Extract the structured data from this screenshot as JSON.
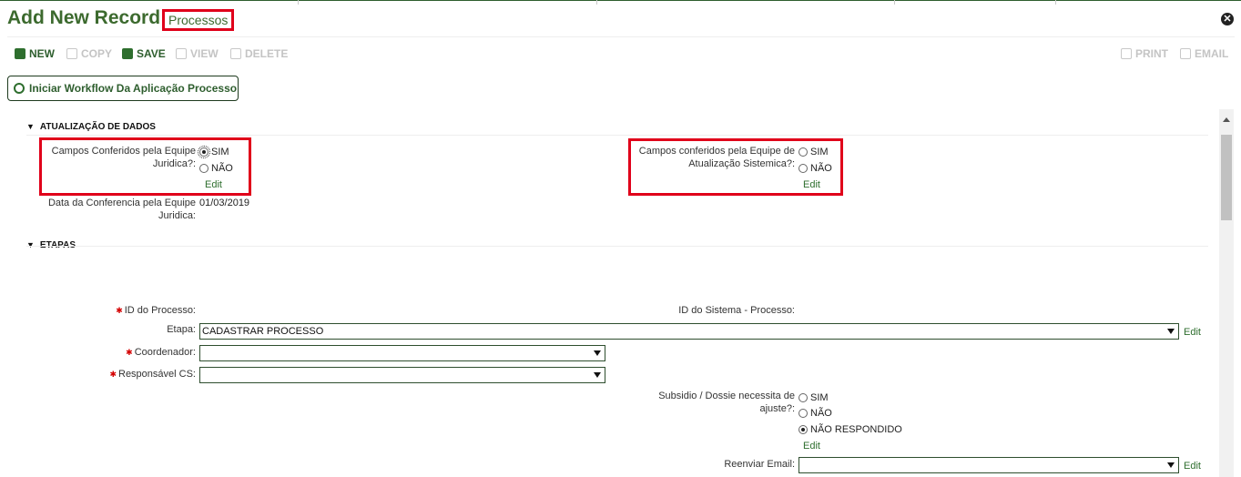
{
  "header": {
    "title": "Add New Record",
    "breadcrumb": "Processos",
    "close_icon": "close-circle-icon"
  },
  "toolbar": {
    "new": "NEW",
    "copy": "COPY",
    "save": "SAVE",
    "view": "VIEW",
    "delete": "DELETE",
    "print": "PRINT",
    "email": "EMAIL"
  },
  "workflow_button": "Iniciar Workflow Da Aplicação Processo",
  "sections": {
    "atualizacao": {
      "title": "ATUALIZAÇÃO DE DADOS",
      "campos_juridica": {
        "label": "Campos Conferidos pela Equipe Juridica?:",
        "options": [
          "SIM",
          "NÃO"
        ],
        "selected": "SIM",
        "edit": "Edit"
      },
      "campos_sistemica": {
        "label": "Campos conferidos pela Equipe de Atualização Sistemica?:",
        "options": [
          "SIM",
          "NÃO"
        ],
        "selected": "",
        "edit": "Edit"
      },
      "data_conferencia": {
        "label": "Data da Conferencia pela Equipe Juridica:",
        "value": "01/03/2019"
      }
    },
    "etapas": {
      "title": "ETAPAS",
      "id_processo": {
        "label": "ID do Processo:"
      },
      "id_sistema": {
        "label": "ID do Sistema - Processo:"
      },
      "etapa": {
        "label": "Etapa:",
        "value": "CADASTRAR PROCESSO",
        "edit": "Edit"
      },
      "coordenador": {
        "label": "Coordenador:",
        "value": ""
      },
      "responsavel": {
        "label": "Responsável CS:",
        "value": ""
      },
      "subsidio": {
        "label": "Subsidio / Dossie necessita de ajuste?:",
        "options": [
          "SIM",
          "NÃO",
          "NÃO RESPONDIDO"
        ],
        "selected": "NÃO RESPONDIDO",
        "edit": "Edit"
      },
      "reenviar": {
        "label": "Reenviar Email:",
        "value": "",
        "edit": "Edit"
      }
    }
  },
  "colors": {
    "accent": "#3c6a2e",
    "highlight": "#e0001a",
    "required": "#d40000"
  }
}
